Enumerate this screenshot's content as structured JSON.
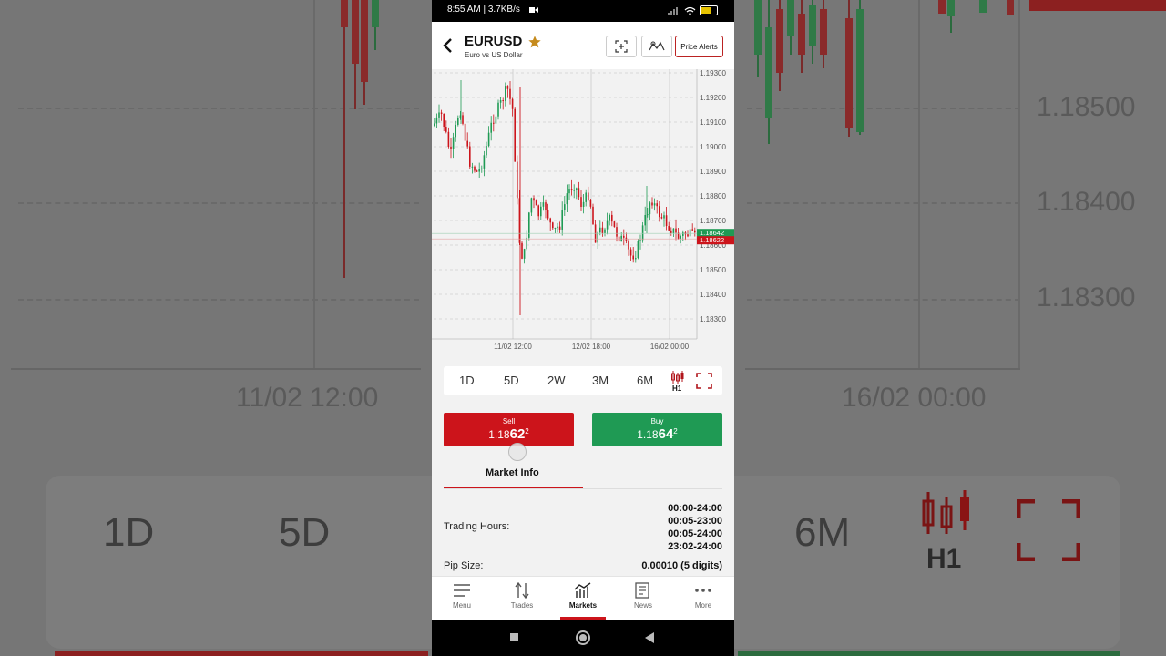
{
  "status_bar": {
    "time_speed": "8:55 AM | 3.7KB/s"
  },
  "header": {
    "symbol": "EURUSD",
    "description": "Euro vs US Dollar",
    "price_alerts_label": "Price Alerts"
  },
  "chart_data": {
    "type": "candlestick",
    "y_ticks": [
      "1.19300",
      "1.19200",
      "1.19100",
      "1.19000",
      "1.18900",
      "1.18800",
      "1.18700",
      "1.18600",
      "1.18500",
      "1.18400",
      "1.18300"
    ],
    "x_ticks": [
      "11/02 12:00",
      "12/02 18:00",
      "16/02 00:00"
    ],
    "price_tag_buy": "1.18642",
    "price_tag_sell": "1.18622",
    "grid": true,
    "buy_color": "#1f9a54",
    "sell_color": "#cc141b"
  },
  "periods": [
    "1D",
    "5D",
    "2W",
    "3M",
    "6M"
  ],
  "interval_label": "H1",
  "sell": {
    "label": "Sell",
    "price_prefix": "1.18",
    "price_big": "62",
    "price_sup": "2"
  },
  "buy": {
    "label": "Buy",
    "price_prefix": "1.18",
    "price_big": "64",
    "price_sup": "2"
  },
  "tabs": {
    "market_info": "Market Info"
  },
  "market_info": {
    "trading_hours_label": "Trading Hours:",
    "trading_hours": [
      "00:00-24:00",
      "00:05-23:00",
      "00:05-24:00",
      "23:02-24:00"
    ],
    "pip_size_label": "Pip Size:",
    "pip_size_value": "0.00010 (5 digits)"
  },
  "bottom_nav": [
    {
      "label": "Menu",
      "icon": "menu-icon"
    },
    {
      "label": "Trades",
      "icon": "trades-icon"
    },
    {
      "label": "Markets",
      "icon": "markets-icon",
      "active": true
    },
    {
      "label": "News",
      "icon": "news-icon"
    },
    {
      "label": "More",
      "icon": "more-icon"
    }
  ],
  "background": {
    "prices": [
      "1.18500",
      "1.18400",
      "1.18300"
    ],
    "dates": [
      "11/02 12:00",
      "16/02 00:00"
    ],
    "periods": [
      "1D",
      "5D",
      "6M"
    ],
    "interval": "H1"
  }
}
